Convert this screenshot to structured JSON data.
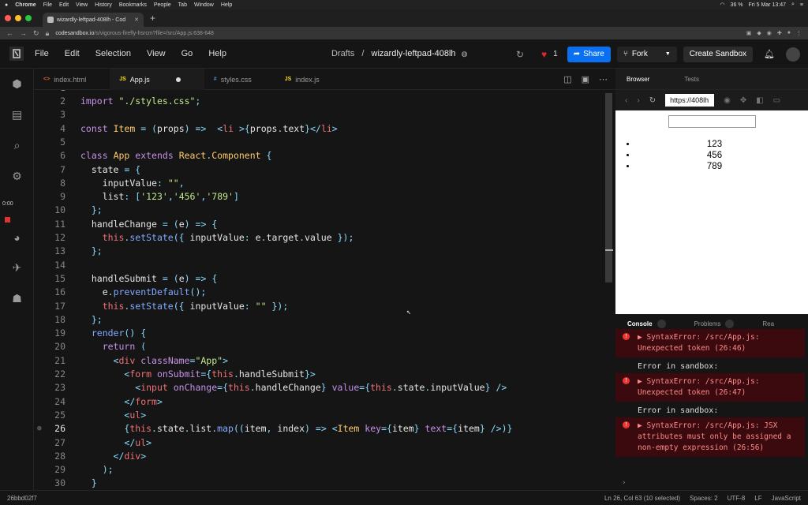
{
  "macbar": {
    "app": "Chrome",
    "menus": [
      "File",
      "Edit",
      "View",
      "History",
      "Bookmarks",
      "People",
      "Tab",
      "Window",
      "Help"
    ],
    "battery": "36 %",
    "datetime": "Fri 5 Mar  13:47"
  },
  "browser": {
    "tab_title": "wizardly-leftpad-408lh - Cod",
    "url_host": "codesandbox.io",
    "url_path": "/s/vigorous-firefly-hsrcm?file=/src/App.js:638-648"
  },
  "app": {
    "menus": [
      "File",
      "Edit",
      "Selection",
      "View",
      "Go",
      "Help"
    ],
    "crumb_folder": "Drafts",
    "crumb_sep": "/",
    "sandbox_name": "wizardly-leftpad-408lh",
    "like_count": "1",
    "share_label": "Share",
    "fork_label": "Fork",
    "create_label": "Create Sandbox"
  },
  "timer": "0:00",
  "editor_tabs": [
    {
      "icon": "<>",
      "label": "index.html",
      "color": "#e96228"
    },
    {
      "icon": "JS",
      "label": "App.js",
      "color": "#f7df1e"
    },
    {
      "icon": "#",
      "label": "styles.css",
      "color": "#3b8fd9"
    },
    {
      "icon": "JS",
      "label": "index.js",
      "color": "#f7df1e"
    }
  ],
  "code_lines": [
    {
      "n": "2",
      "code": "import \"./styles.css\";"
    },
    {
      "n": "3",
      "code": ""
    },
    {
      "n": "4",
      "code": "const Item = (props) =>  <li >{props.text}</li>"
    },
    {
      "n": "5",
      "code": ""
    },
    {
      "n": "6",
      "code": "class App extends React.Component {"
    },
    {
      "n": "7",
      "code": "  state = {"
    },
    {
      "n": "8",
      "code": "    inputValue: \"\","
    },
    {
      "n": "9",
      "code": "    list: ['123','456','789']"
    },
    {
      "n": "10",
      "code": "  };"
    },
    {
      "n": "11",
      "code": "  handleChange = (e) => {"
    },
    {
      "n": "12",
      "code": "    this.setState({ inputValue: e.target.value });"
    },
    {
      "n": "13",
      "code": "  };"
    },
    {
      "n": "14",
      "code": ""
    },
    {
      "n": "15",
      "code": "  handleSubmit = (e) => {"
    },
    {
      "n": "16",
      "code": "    e.preventDefault();"
    },
    {
      "n": "17",
      "code": "    this.setState({ inputValue: \"\" });"
    },
    {
      "n": "18",
      "code": "  };"
    },
    {
      "n": "19",
      "code": "  render() {"
    },
    {
      "n": "20",
      "code": "    return ("
    },
    {
      "n": "21",
      "code": "      <div className=\"App\">"
    },
    {
      "n": "22",
      "code": "        <form onSubmit={this.handleSubmit}>"
    },
    {
      "n": "23",
      "code": "          <input onChange={this.handleChange} value={this.state.inputValue} />"
    },
    {
      "n": "24",
      "code": "        </form>"
    },
    {
      "n": "25",
      "code": "        <ul>"
    },
    {
      "n": "26",
      "code": "        {this.state.list.map((item, index) => <Item key={item} text={item} />)}"
    },
    {
      "n": "27",
      "code": "        </ul>"
    },
    {
      "n": "28",
      "code": "      </div>"
    },
    {
      "n": "29",
      "code": "    );"
    },
    {
      "n": "30",
      "code": "  }"
    }
  ],
  "preview": {
    "tabs": [
      "Browser",
      "Tests"
    ],
    "url": "https://408lh",
    "list_items": [
      "123",
      "456",
      "789"
    ]
  },
  "console": {
    "tabs": [
      "Console",
      "Problems",
      "Rea"
    ],
    "entries": [
      {
        "type": "error",
        "text": "▶ SyntaxError: /src/App.js: Unexpected token (26:46)"
      },
      {
        "type": "info",
        "text": "Error in sandbox:"
      },
      {
        "type": "error",
        "text": "▶ SyntaxError: /src/App.js: Unexpected token (26:47)"
      },
      {
        "type": "info",
        "text": "Error in sandbox:"
      },
      {
        "type": "error",
        "text": "▶ SyntaxError: /src/App.js: JSX attributes must only be assigned a non-empty expression (26:56)"
      }
    ]
  },
  "status": {
    "commit": "26bbd02f7",
    "position": "Ln 26, Col 63 (10 selected)",
    "spaces": "Spaces: 2",
    "encoding": "UTF-8",
    "eol": "LF",
    "language": "JavaScript"
  }
}
